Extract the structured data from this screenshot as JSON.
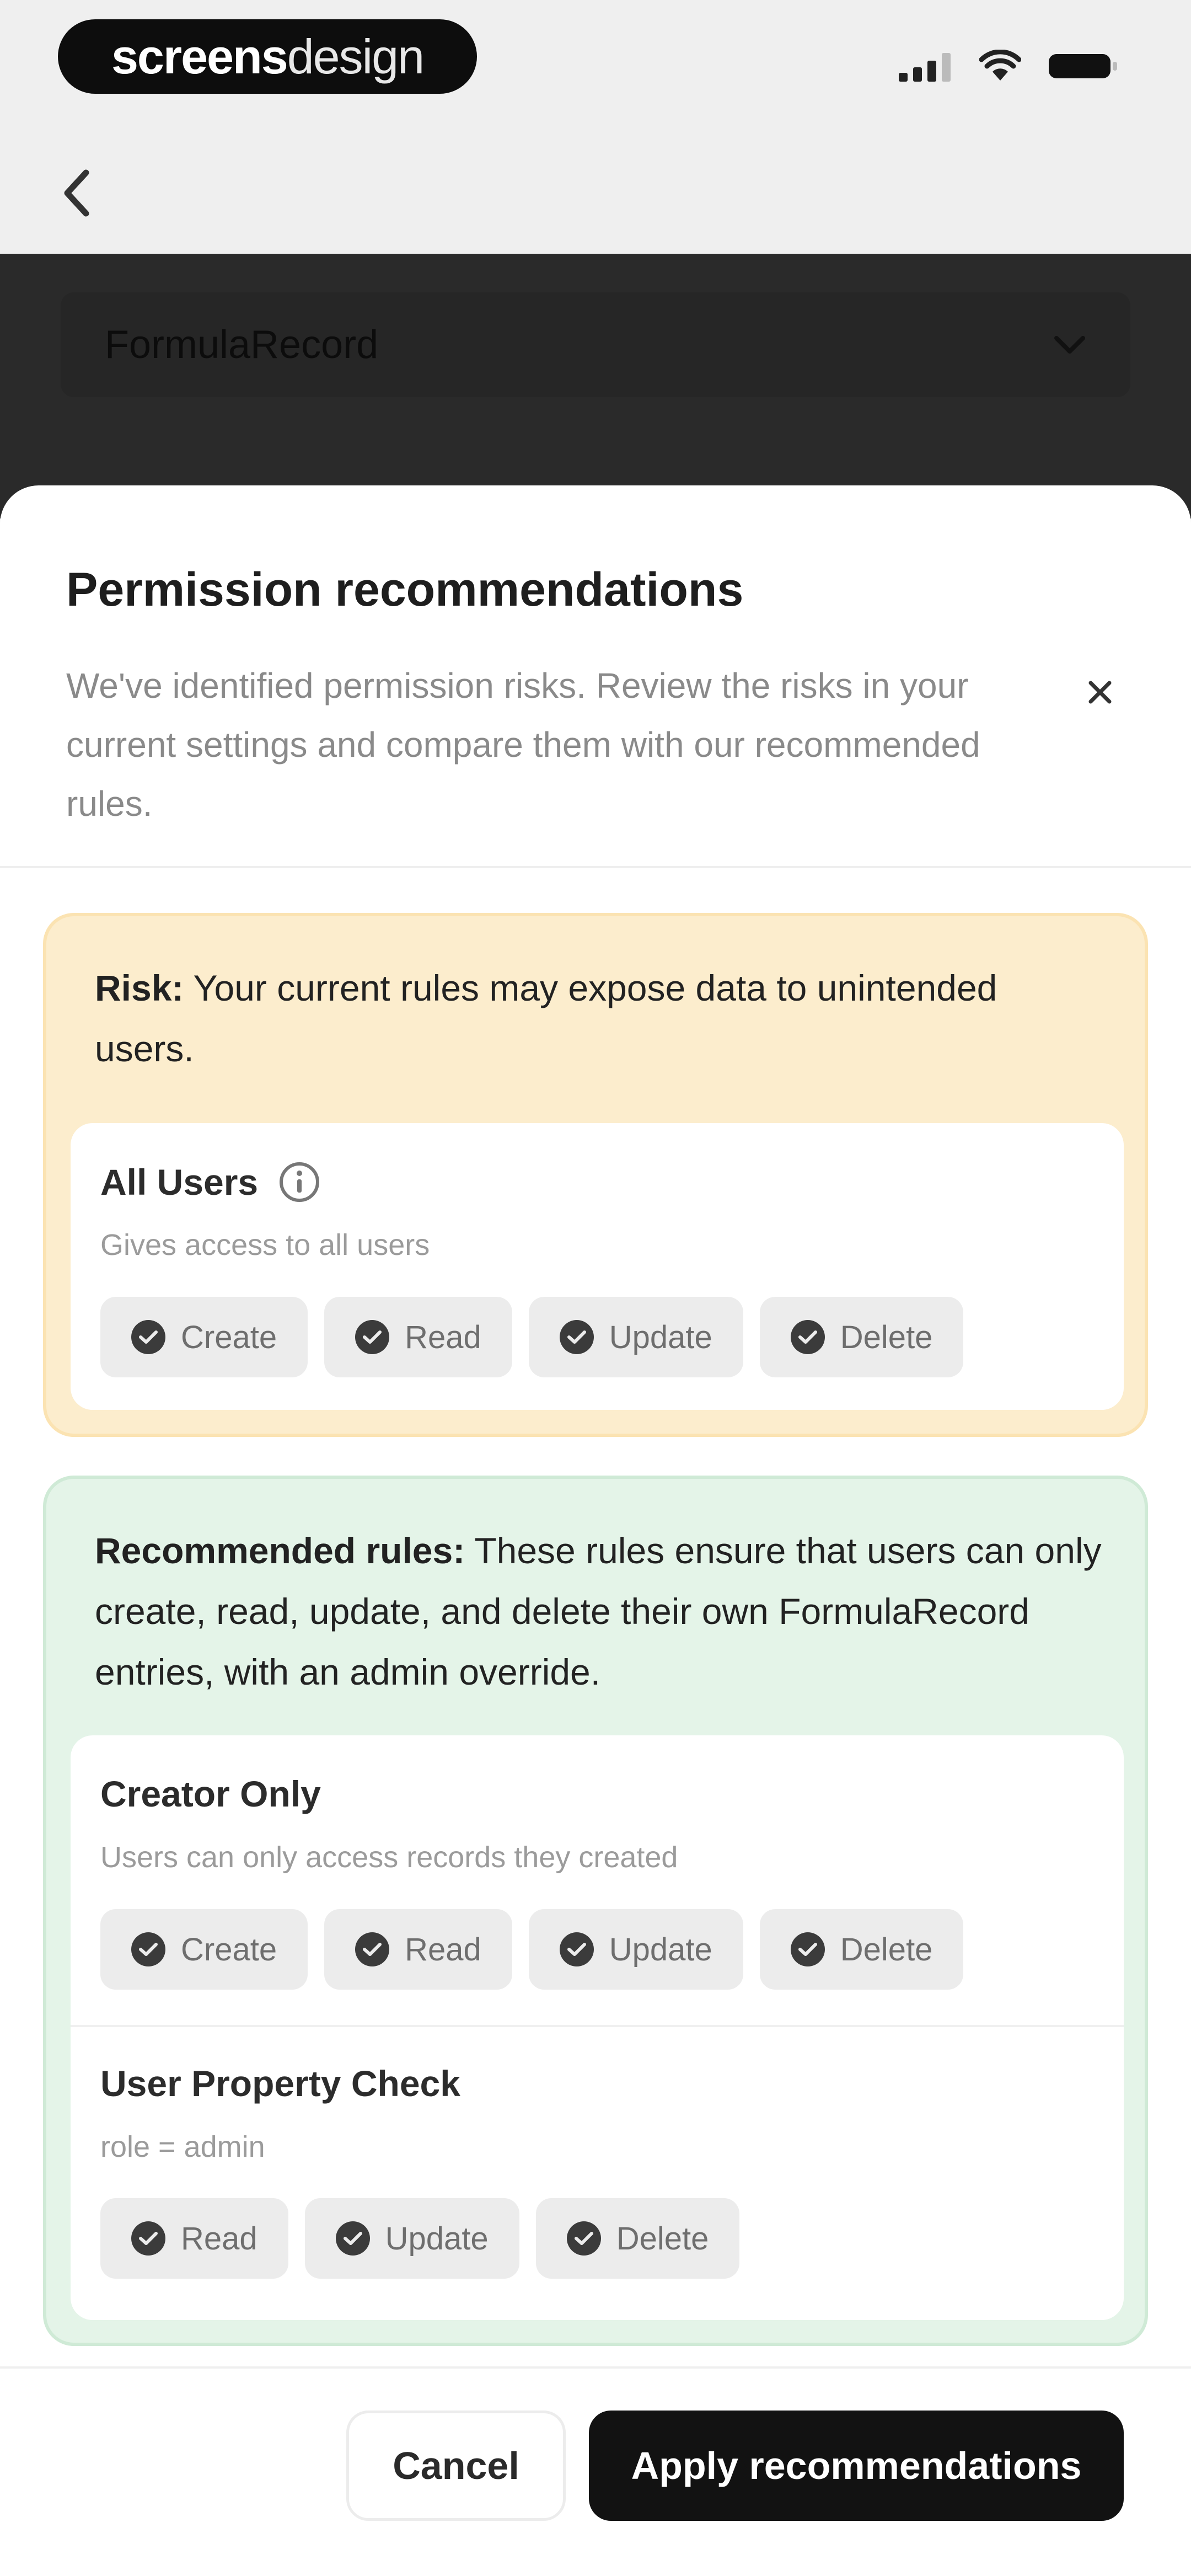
{
  "status_bar": {
    "brand_bold": "screens",
    "brand_light": "design",
    "icons": [
      "signal-icon",
      "wifi-icon",
      "battery-icon"
    ]
  },
  "nav": {
    "back_icon": "chevron-left-icon"
  },
  "select": {
    "value": "FormulaRecord",
    "icon": "chevron-down-icon"
  },
  "sheet": {
    "title": "Permission recommendations",
    "description": "We've identified permission risks. Review the risks in your current settings and compare them with our recommended rules.",
    "close_icon": "close-icon"
  },
  "risk": {
    "label": "Risk:",
    "text": " Your current rules may expose data to unintended users.",
    "rule": {
      "title": "All Users",
      "info_icon": "info-icon",
      "description": "Gives access to all users",
      "permissions": [
        "Create",
        "Read",
        "Update",
        "Delete"
      ]
    }
  },
  "recommended": {
    "label": "Recommended rules:",
    "text": " These rules ensure that users can only create, read, update, and delete their own FormulaRecord entries, with an admin override.",
    "rules": [
      {
        "title": "Creator Only",
        "description": "Users can only access records they created",
        "permissions": [
          "Create",
          "Read",
          "Update",
          "Delete"
        ]
      },
      {
        "title": "User Property Check",
        "description": "role = admin",
        "permissions": [
          "Read",
          "Update",
          "Delete"
        ]
      }
    ]
  },
  "footer": {
    "cancel_label": "Cancel",
    "apply_label": "Apply recommendations"
  },
  "colors": {
    "risk_bg": "#fcedcd",
    "recommended_bg": "#e4f4e8",
    "primary_button": "#121212"
  }
}
